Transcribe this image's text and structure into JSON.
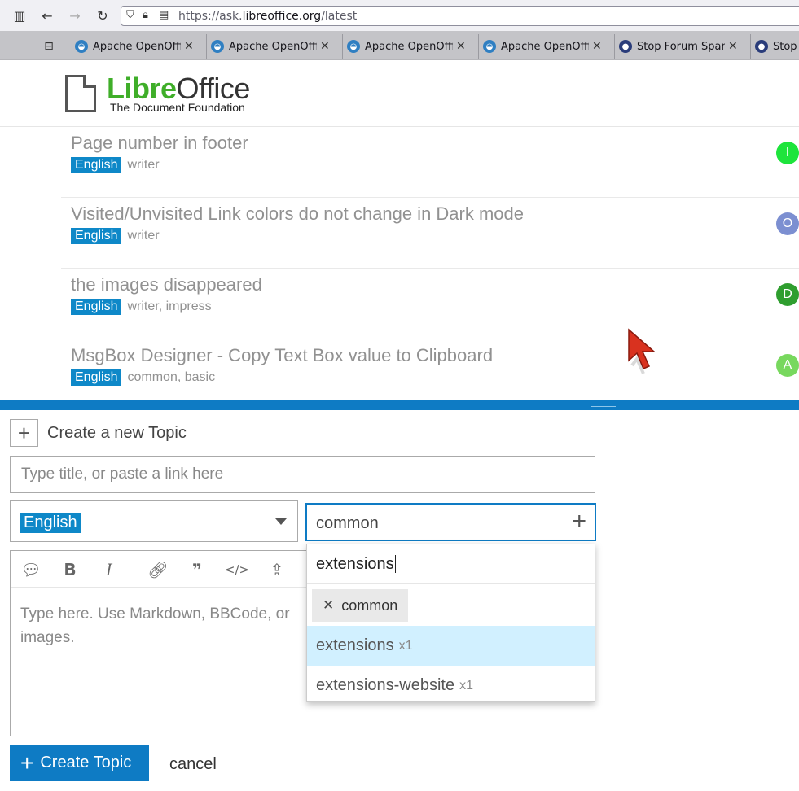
{
  "browser": {
    "url_prefix": "https://ask.",
    "url_domain": "libreoffice.org",
    "url_path": "/latest",
    "tabs": [
      {
        "label": "Apache OpenOffice",
        "favicon": "openoffice-icon"
      },
      {
        "label": "Apache OpenOffice",
        "favicon": "openoffice-icon"
      },
      {
        "label": "Apache OpenOffice",
        "favicon": "openoffice-icon"
      },
      {
        "label": "Apache OpenOffice",
        "favicon": "openoffice-icon"
      },
      {
        "label": "Stop Forum Spam",
        "favicon": "stopforumspam-icon"
      },
      {
        "label": "Stop",
        "favicon": "stopforumspam-icon"
      }
    ]
  },
  "header": {
    "logo_libre": "Libre",
    "logo_office": "Office",
    "logo_sub": "The Document Foundation"
  },
  "topics": [
    {
      "title": "Page number in footer",
      "category": "English",
      "tags": "writer",
      "avatar_letter": "I",
      "avatar_color": "#1ee43c"
    },
    {
      "title": "Visited/Unvisited Link colors do not change in Dark mode",
      "category": "English",
      "tags": "writer",
      "avatar_letter": "O",
      "avatar_color": "#7c8fd1"
    },
    {
      "title": "the images disappeared",
      "category": "English",
      "tags": "writer, impress",
      "avatar_letter": "D",
      "avatar_color": "#2f9e2f"
    },
    {
      "title": "MsgBox Designer - Copy Text Box value to Clipboard",
      "category": "English",
      "tags": "common, basic",
      "avatar_letter": "A",
      "avatar_color": "#78d85e"
    }
  ],
  "composer": {
    "new_topic_label": "Create a new Topic",
    "title_placeholder": "Type title, or paste a link here",
    "category_selected": "English",
    "tag_value": "common",
    "editor_placeholder": "Type here. Use Markdown, BBCode, or HTML to format. Drag or paste images.",
    "editor_visible_line1": "Type here. Use Markdown, BBCode, or",
    "editor_visible_line2": "images.",
    "create_button": "Create Topic",
    "cancel_link": "cancel"
  },
  "tag_dropdown": {
    "filter_value": "extensions",
    "selected_chip": "common",
    "options": [
      {
        "label": "extensions",
        "count": "x1"
      },
      {
        "label": "extensions-website",
        "count": "x1"
      }
    ]
  },
  "colors": {
    "brand_blue": "#0e7bc4",
    "category_blue": "#0e88c8",
    "logo_green": "#3fae29",
    "highlight": "#d1f0ff"
  }
}
